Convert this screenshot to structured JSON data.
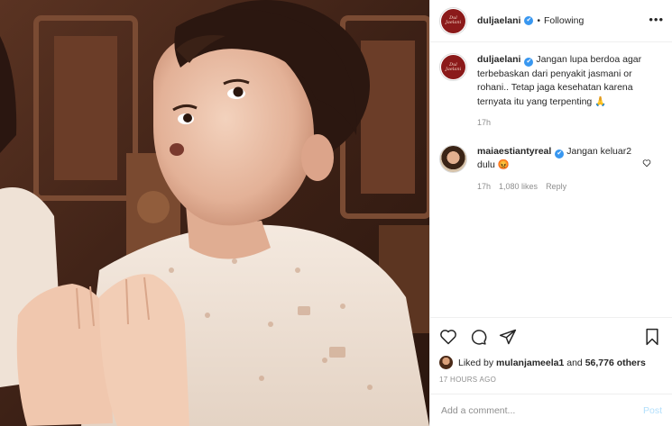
{
  "header": {
    "avatar_text": "Dul Jaelani",
    "username": "duljaelani",
    "verified_glyph": "✔",
    "separator": "•",
    "follow_state": "Following",
    "more_glyph": "•••"
  },
  "caption": {
    "username": "duljaelani",
    "text": "Jangan lupa berdoa agar terbebaskan dari penyakit jasmani or rohani.. Tetap jaga kesehatan karena ternyata itu yang terpenting 🙏",
    "time": "17h"
  },
  "reply": {
    "username": "maiaestiantyreal",
    "text": "Jangan keluar2 dulu 😡",
    "time": "17h",
    "likes": "1,080 likes",
    "reply_label": "Reply"
  },
  "actions": {
    "icons": [
      "heart-icon",
      "comment-icon",
      "share-icon",
      "bookmark-icon"
    ]
  },
  "likes": {
    "prefix": "Liked by",
    "user": "mulanjameela1",
    "middle": "and",
    "others": "56,776 others"
  },
  "timestamp": "17 HOURS AGO",
  "comment_box": {
    "placeholder": "Add a comment...",
    "post_label": "Post"
  },
  "colors": {
    "accent": "#3897f0",
    "post_disabled": "#b2dffc",
    "muted": "#8e8e8e",
    "text": "#262626"
  }
}
